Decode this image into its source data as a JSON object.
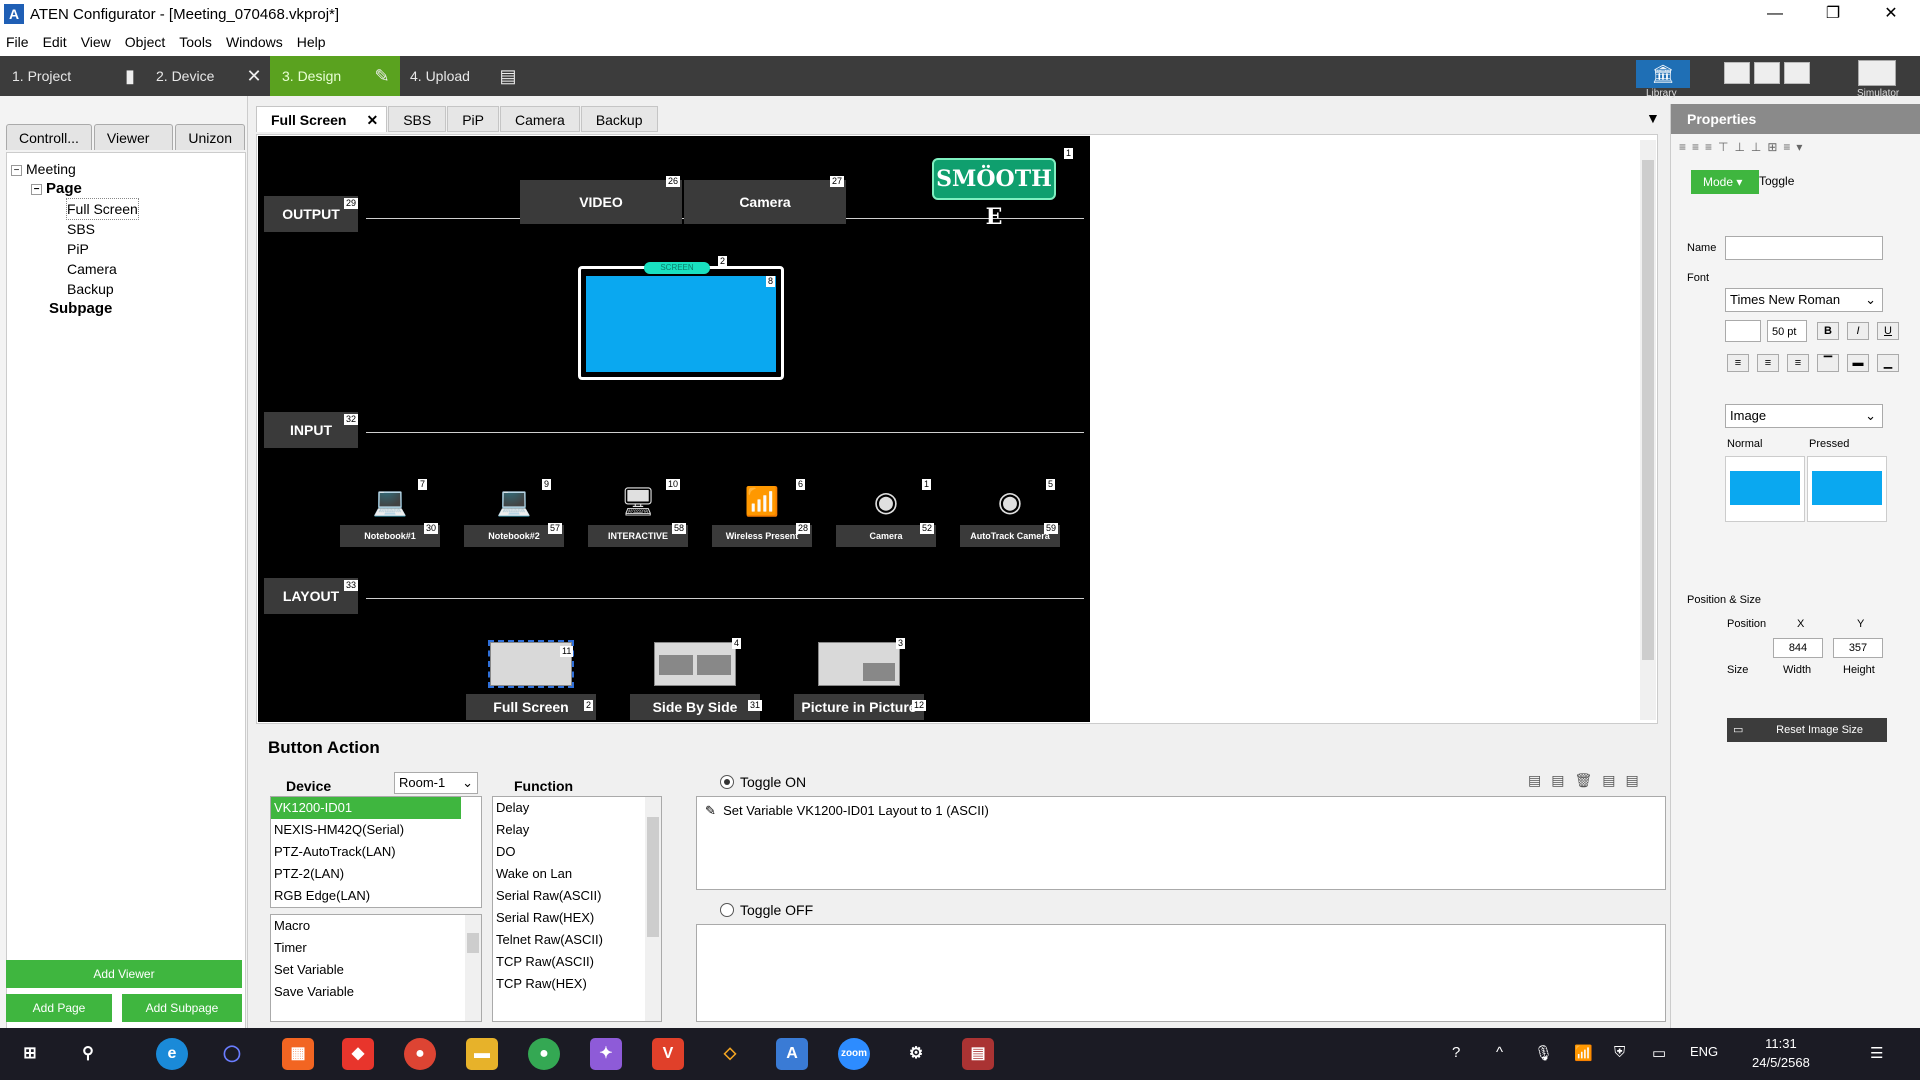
{
  "window": {
    "title": "ATEN Configurator - [Meeting_070468.vkproj*]",
    "app_icon": "aten-logo-icon",
    "minimize": "—",
    "restore": "❐",
    "close": "✕"
  },
  "menu": [
    "File",
    "Edit",
    "View",
    "Object",
    "Tools",
    "Windows",
    "Help"
  ],
  "steps": [
    {
      "label": "1. Project",
      "icon": "document-icon"
    },
    {
      "label": "2. Device",
      "icon": "tools-icon"
    },
    {
      "label": "3. Design",
      "icon": "pencil-icon"
    },
    {
      "label": "4. Upload",
      "icon": "upload-icon"
    }
  ],
  "toolbar": {
    "library_label": "Library",
    "simulator_label": "Simulator"
  },
  "left_panel": {
    "tabs": [
      "Controll...",
      "Viewer ...",
      "Unizon"
    ],
    "tree": {
      "root": "Meeting",
      "page": "Page",
      "pages": [
        "Full Screen",
        "SBS",
        "PiP",
        "Camera",
        "Backup"
      ],
      "subpage": "Subpage"
    },
    "add_viewer": "Add Viewer",
    "add_page": "Add Page",
    "add_subpage": "Add Subpage"
  },
  "design_tabs": {
    "active": "Full Screen",
    "close": "✕",
    "others": [
      "SBS",
      "PiP",
      "Camera",
      "Backup"
    ]
  },
  "design": {
    "output_label": "OUTPUT",
    "output_tag": "29",
    "output_buttons": [
      {
        "label": "VIDEO",
        "tag": "26"
      },
      {
        "label": "Camera",
        "tag": "27"
      }
    ],
    "logo_text": "SMÖOTH E",
    "logo_tag": "1",
    "screen_tag_top": "2",
    "screen_tag_right": "8",
    "screen_pill": "SCREEN",
    "input_label": "INPUT",
    "input_tag": "32",
    "inputs": [
      {
        "label": "Notebook#1",
        "icon": "laptop-icon",
        "tag_top": "7",
        "tag_bottom": "30"
      },
      {
        "label": "Notebook#2",
        "icon": "laptop-icon",
        "tag_top": "9",
        "tag_bottom": "57"
      },
      {
        "label": "INTERACTIVE",
        "icon": "interactive-display-icon",
        "tag_top": "10",
        "tag_bottom": "58"
      },
      {
        "label": "Wireless Present",
        "icon": "wifi-router-icon",
        "tag_top": "6",
        "tag_bottom": "28"
      },
      {
        "label": "Camera",
        "icon": "webcam-icon",
        "tag_top": "1",
        "tag_bottom": "52"
      },
      {
        "label": "AutoTrack Camera",
        "icon": "webcam-icon",
        "tag_top": "5",
        "tag_bottom": "59"
      }
    ],
    "layout_label": "LAYOUT",
    "layout_tag": "33",
    "layouts": [
      {
        "label": "Full Screen",
        "tag_top": "11",
        "tag_bottom": "2"
      },
      {
        "label": "Side By Side",
        "tag_top": "4",
        "tag_bottom": "31"
      },
      {
        "label": "Picture in Picture",
        "tag_top": "3",
        "tag_bottom": "12"
      }
    ]
  },
  "properties": {
    "title": "Properties",
    "mode_label": "Mode",
    "mode_value": "Toggle",
    "name_label": "Name",
    "name_value": "",
    "font_label": "Font",
    "font_value": "Times New Roman",
    "font_size": "50 pt",
    "bold": "B",
    "italic": "I",
    "underline": "U",
    "fill_type": "Image",
    "normal_label": "Normal",
    "pressed_label": "Pressed",
    "pos_size_label": "Position & Size",
    "position_label": "Position",
    "size_label": "Size",
    "x_label": "X",
    "y_label": "Y",
    "x_value": "844",
    "y_value": "357",
    "width_label": "Width",
    "height_label": "Height",
    "reset_label": "Reset Image Size"
  },
  "action": {
    "title": "Button Action",
    "device_label": "Device",
    "room_value": "Room-1",
    "devices": [
      "VK1200-ID01",
      "NEXIS-HM42Q(Serial)",
      "PTZ-AutoTrack(LAN)",
      "PTZ-2(LAN)",
      "RGB Edge(LAN)"
    ],
    "selected_device": 0,
    "system_items": [
      "Macro",
      "Timer",
      "Set Variable",
      "Save Variable"
    ],
    "function_label": "Function",
    "functions": [
      "Delay",
      "Relay",
      "DO",
      "Wake on Lan",
      "Serial Raw(ASCII)",
      "Serial Raw(HEX)",
      "Telnet Raw(ASCII)",
      "TCP Raw(ASCII)",
      "TCP Raw(HEX)"
    ],
    "toggle_on_label": "Toggle ON",
    "toggle_on_command": "Set Variable VK1200-ID01 Layout to 1 (ASCII)",
    "toggle_off_label": "Toggle OFF"
  },
  "taskbar": {
    "apps": [
      "windows-start-icon",
      "search-icon",
      "edge-icon",
      "cortana-icon",
      "app-grid-icon",
      "anydesk-icon",
      "chrome-icon",
      "file-explorer-icon",
      "chrome-icon",
      "copilot-icon",
      "vivaldi-icon",
      "sketch-icon",
      "aten-configurator-icon",
      "zoom-icon",
      "settings-icon",
      "winrar-icon"
    ],
    "language": "ENG",
    "time": "11:31",
    "date": "24/5/2568"
  },
  "colors": {
    "accent_green": "#3fb63f",
    "screen_blue": "#0aa8f0",
    "toolbar_dark": "#3c3c3c",
    "library_blue": "#1f6fb5"
  }
}
